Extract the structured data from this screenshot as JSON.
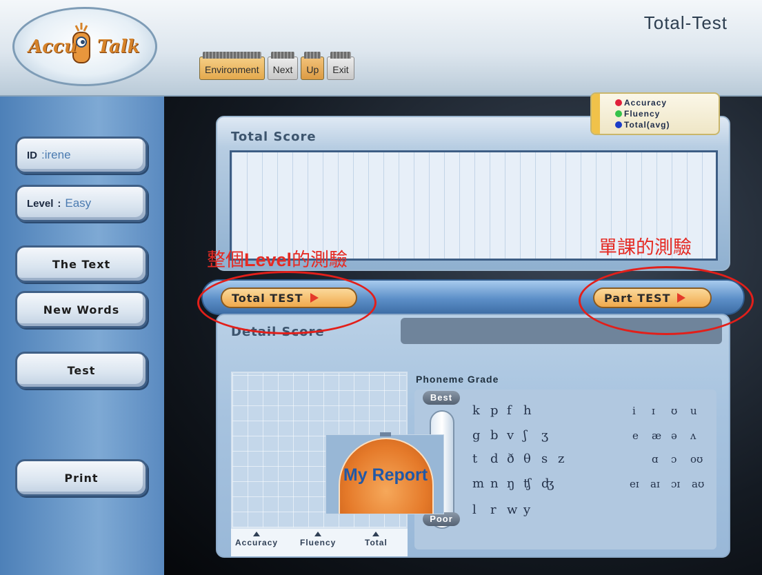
{
  "header": {
    "title": "Total-Test",
    "logo_text_left": "Accu",
    "logo_text_right": "Talk",
    "nav": [
      "Environment",
      "Next",
      "Up",
      "Exit"
    ]
  },
  "sidebar": {
    "id_key": "ID",
    "id_value": ":irene",
    "level_key": "Level",
    "level_value": "Easy",
    "buttons": [
      "The Text",
      "New Words",
      "Test",
      "Print"
    ]
  },
  "legend": {
    "items": [
      {
        "label": "Accuracy",
        "color": "#e0203a"
      },
      {
        "label": "Fluency",
        "color": "#35c24a"
      },
      {
        "label": "Total(avg)",
        "color": "#1b3dc8"
      }
    ]
  },
  "total_score": {
    "title": "Total Score"
  },
  "annotations": {
    "left_prefix": "整個",
    "left_level": "Level",
    "left_suffix": "的測驗",
    "right": "單課的測驗"
  },
  "tests": {
    "total": "Total TEST",
    "part": "Part TEST"
  },
  "detail": {
    "title": "Detail Score",
    "axis": [
      "Accuracy",
      "Fluency",
      "Total"
    ],
    "phoneme_title": "Phoneme Grade",
    "grade_best": "Best",
    "grade_poor": "Poor",
    "consonants": [
      [
        "k",
        "p",
        "f",
        "h"
      ],
      [
        "g",
        "b",
        "v",
        "ʃ",
        "ʒ"
      ],
      [
        "t",
        "d",
        "ð",
        "θ",
        "s",
        "z"
      ],
      [
        "m",
        "n",
        "ŋ",
        "ʧ",
        "ʤ"
      ],
      [
        "l",
        "r",
        "w",
        "y"
      ]
    ],
    "vowels": [
      [
        "i",
        "ɪ",
        "ʊ",
        "u"
      ],
      [
        "e",
        "æ",
        "ə",
        "ʌ"
      ],
      [
        "ɑ",
        "ɔ",
        "oʊ"
      ],
      [
        "eɪ",
        "aɪ",
        "ɔɪ",
        "aʊ"
      ]
    ]
  },
  "report": {
    "label": "My Report"
  }
}
